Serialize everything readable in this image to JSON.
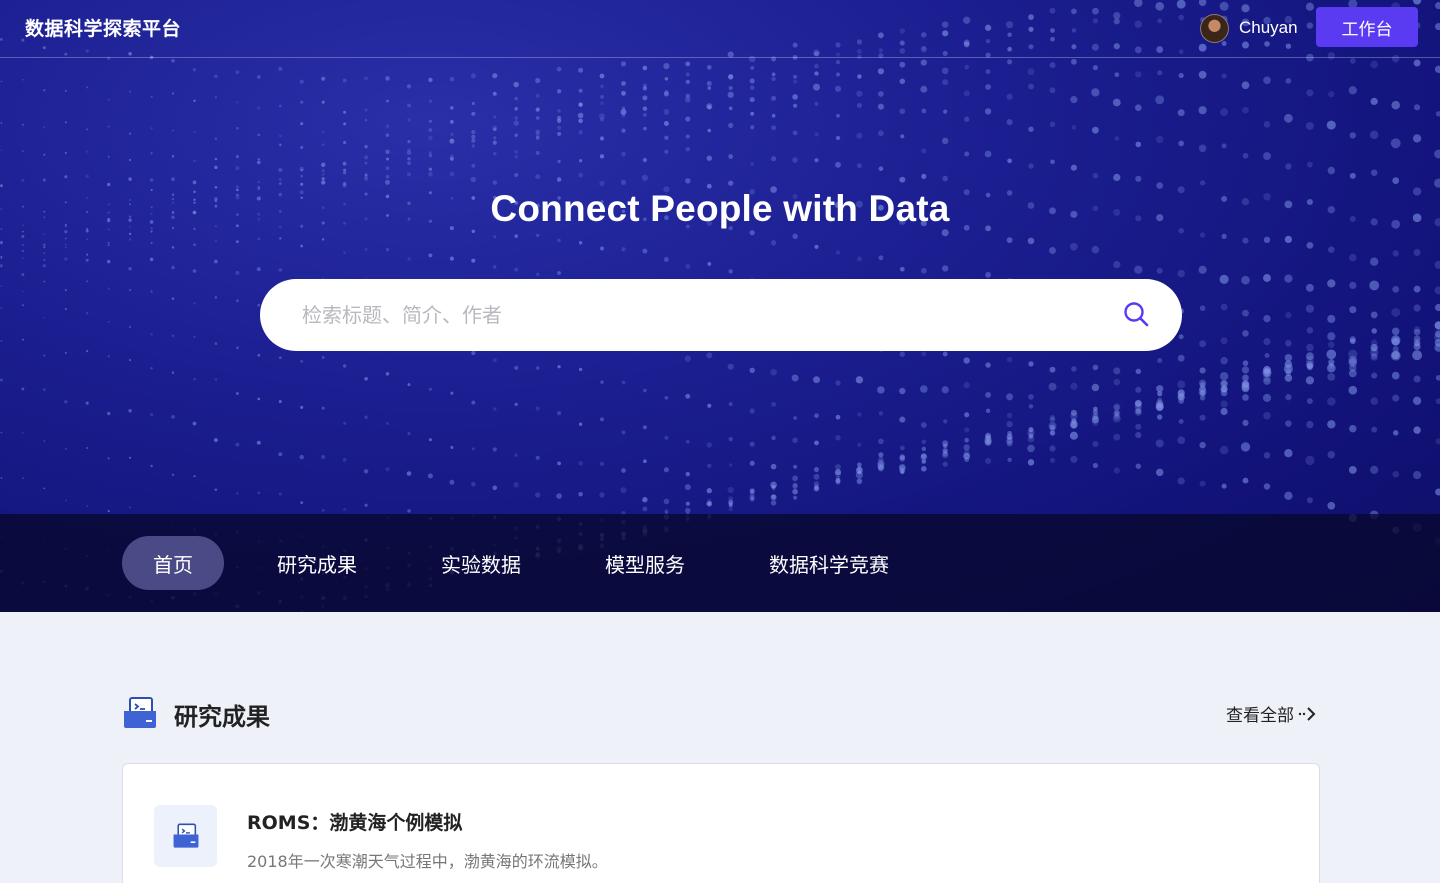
{
  "header": {
    "brand": "数据科学探索平台",
    "user_name": "Chuyan",
    "workbench_label": "工作台"
  },
  "hero": {
    "title": "Connect People with Data",
    "search_placeholder": "检索标题、简介、作者"
  },
  "nav": {
    "items": [
      {
        "label": "首页",
        "active": true
      },
      {
        "label": "研究成果",
        "active": false
      },
      {
        "label": "实验数据",
        "active": false
      },
      {
        "label": "模型服务",
        "active": false
      },
      {
        "label": "数据科学竞赛",
        "active": false
      }
    ]
  },
  "section": {
    "title": "研究成果",
    "view_all_label": "查看全部"
  },
  "cards": [
    {
      "title": "ROMS：渤黄海个例模拟",
      "description": "2018年一次寒潮天气过程中，渤黄海的环流模拟。"
    }
  ],
  "colors": {
    "hero_bg": "#1b1e90",
    "accent": "#5b3bf2",
    "nav_active_bg": "#4a4b86",
    "page_bg": "#eef1f8"
  },
  "icons": {
    "search": "search-icon",
    "section": "terminal-tray-icon",
    "arrow": "dotted-arrow-right-icon"
  }
}
